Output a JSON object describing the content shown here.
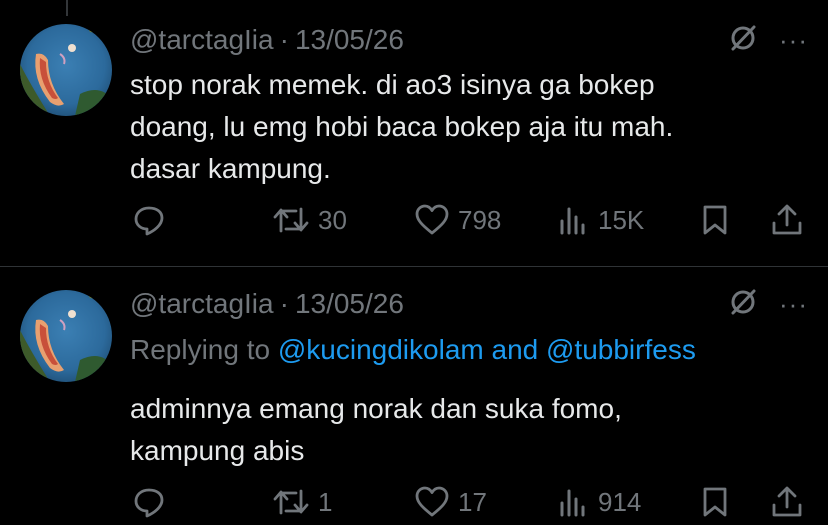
{
  "tweets": [
    {
      "handle": "@tarctagIia",
      "date": "13/05/26",
      "separator": "·",
      "more": "···",
      "body_lines": [
        "stop norak memek. di ao3 isinya ga bokep",
        "doang, lu emg hobi baca bokep aja itu mah.",
        "dasar kampung."
      ],
      "retweets": "30",
      "likes": "798",
      "views": "15K"
    },
    {
      "handle": "@tarctagIia",
      "date": "13/05/26",
      "separator": "·",
      "more": "···",
      "replying_prefix": "Replying to",
      "replying_user1": "@kucingdikolam",
      "replying_and": "and",
      "replying_user2": "@tubbirfess",
      "body_lines": [
        "adminnya emang norak dan suka fomo,",
        "kampung abis"
      ],
      "retweets": "1",
      "likes": "17",
      "views": "914"
    }
  ],
  "icons": {
    "reply": "reply-icon",
    "retweet": "retweet-icon",
    "like": "heart-icon",
    "views": "views-icon",
    "bookmark": "bookmark-icon",
    "share": "share-icon",
    "grok": "grok-icon",
    "more": "more-icon"
  },
  "colors": {
    "background": "#000000",
    "text": "#e7e9ea",
    "muted": "#71767b",
    "link": "#1d9bf0",
    "divider": "#2f3336"
  }
}
